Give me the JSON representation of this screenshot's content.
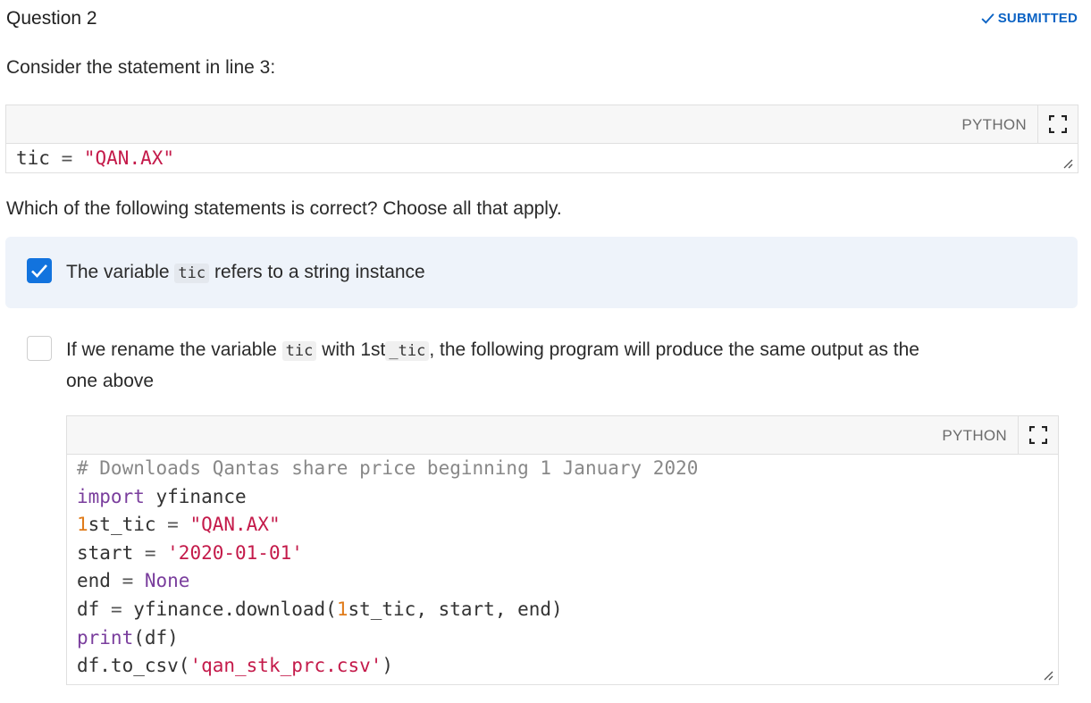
{
  "question": {
    "title": "Question 2",
    "status": "SUBMITTED",
    "prompt": "Consider the statement in line 3:",
    "instruction": "Which of the following statements is correct? Choose all that apply."
  },
  "snippet": {
    "language": "PYTHON",
    "tokens": [
      {
        "t": "tic",
        "c": "plain"
      },
      {
        "t": " = ",
        "c": "op"
      },
      {
        "t": "\"QAN.AX\"",
        "c": "string"
      }
    ]
  },
  "options": [
    {
      "checked": true,
      "text_before": "The variable ",
      "code": "tic",
      "text_after": " refers to a string instance"
    },
    {
      "checked": false,
      "text_before": "If we rename the variable ",
      "code": "tic",
      "text_mid": "with 1st",
      "code2": "_tic",
      "text_after": ", the following program will produce the same output as the",
      "text_line2": "one above"
    }
  ],
  "program": {
    "language": "PYTHON",
    "lines": [
      [
        {
          "t": "# Downloads Qantas share price beginning 1 January 2020",
          "c": "comment"
        }
      ],
      [
        {
          "t": "import",
          "c": "keyword"
        },
        {
          "t": " yfinance",
          "c": "plain"
        }
      ],
      [
        {
          "t": "1",
          "c": "number"
        },
        {
          "t": "st_tic",
          "c": "plain"
        },
        {
          "t": " = ",
          "c": "op"
        },
        {
          "t": "\"QAN.AX\"",
          "c": "string"
        }
      ],
      [
        {
          "t": "start",
          "c": "plain"
        },
        {
          "t": " = ",
          "c": "op"
        },
        {
          "t": "'2020-01-01'",
          "c": "string"
        }
      ],
      [
        {
          "t": "end",
          "c": "plain"
        },
        {
          "t": " = ",
          "c": "op"
        },
        {
          "t": "None",
          "c": "keyword"
        }
      ],
      [
        {
          "t": "df",
          "c": "plain"
        },
        {
          "t": " = ",
          "c": "op"
        },
        {
          "t": "yfinance.download(",
          "c": "plain"
        },
        {
          "t": "1",
          "c": "number"
        },
        {
          "t": "st_tic, start, end)",
          "c": "plain"
        }
      ],
      [
        {
          "t": "print",
          "c": "keyword"
        },
        {
          "t": "(df)",
          "c": "plain"
        }
      ],
      [
        {
          "t": "df.to_csv(",
          "c": "plain"
        },
        {
          "t": "'qan_stk_prc.csv'",
          "c": "string"
        },
        {
          "t": ")",
          "c": "plain"
        }
      ]
    ]
  },
  "colors": {
    "accent": "#1273de",
    "status": "#0b63c4",
    "selected_bg": "#eef3fa"
  },
  "icons": {
    "status": "check-icon",
    "fullscreen": "fullscreen-icon",
    "resize": "resize-handle-icon"
  }
}
